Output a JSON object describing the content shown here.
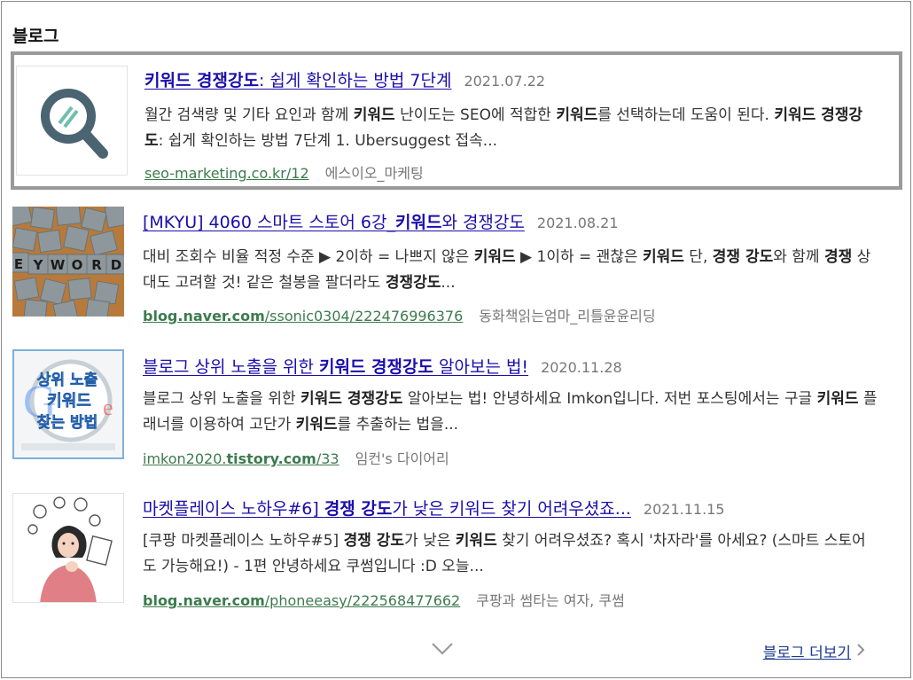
{
  "section": {
    "title": "블로그"
  },
  "items": [
    {
      "title_pre": "",
      "title_bold": "키워드 경쟁강도",
      "title_post": ": 쉽게 확인하는 방법 7단계",
      "date": "2021.07.22",
      "desc_html": "월간 검색량 및 기타 요인과 함께 <b>키워드</b> 난이도는 SEO에 적합한 <b>키워드</b>를 선택하는데 도움이 된다. <b>키워드 경쟁강도</b>: 쉽게 확인하는 방법 7단계 1. Ubersuggest 접속...",
      "url_pre": "seo-marketing.co.kr/12",
      "url_bold": "",
      "url_post": "",
      "writer": "에스이오_마케팅",
      "thumb_icon": "magnifier-icon"
    },
    {
      "title_pre": "[MKYU] 4060 스마트 스토어 6강_",
      "title_bold": "키워드",
      "title_post": "와 경쟁강도",
      "date": "2021.08.21",
      "desc_html": "대비 조회수 비율 적정 수준 ▶ 2이하 = 나쁘지 않은 <b>키워드</b> ▶ 1이하 = 괜찮은 <b>키워드</b>  단, <b>경쟁 강도</b>와 함께 <b>경쟁</b> 상대도 고려할 것!  같은 철봉을 팔더라도 <b>경쟁강도</b>...",
      "url_pre": "",
      "url_bold": "blog.naver.com",
      "url_post": "/ssonic0304/222476996376",
      "writer": "동화책읽는엄마_리틀윤윤리딩",
      "thumb_icon": "keyword-tiles-image"
    },
    {
      "title_pre": "블로그 상위 노출을 위한 ",
      "title_bold": "키워드 경쟁강도",
      "title_post": " 알아보는 법!",
      "date": "2020.11.28",
      "desc_html": "블로그 상위 노출을 위한 <b>키워드 경쟁강도</b> 알아보는 법! 안녕하세요 Imkon입니다. 저번 포스팅에서는 구글 <b>키워드</b> 플래너를 이용하여 고단가 <b>키워드</b>를 추출하는 법을...",
      "url_pre": "imkon2020.",
      "url_bold": "tistory.com",
      "url_post": "/33",
      "writer": "임컨's 다이어리",
      "thumb_icon": "google-keyword-thumb",
      "thumb_text": [
        "상위 노출",
        "키워드",
        "찾는 방법"
      ]
    },
    {
      "title_pre": "마켓플레이스 노하우#6] ",
      "title_bold": "경쟁 강도",
      "title_post": "가 낮은 키워드 찾기 어려우셨죠...",
      "date": "2021.11.15",
      "desc_html": "[쿠팡 마켓플레이스 노하우#5] <b>경쟁 강도</b>가 낮은 <b>키워드</b> 찾기 어려우셨죠? 혹시 '차자라'를 아세요? (스마트 스토어도 가능해요!) - 1편 안녕하세요 쿠썸입니다 :D 오늘...",
      "url_pre": "",
      "url_bold": "blog.naver.com",
      "url_post": "/phoneeasy/222568477662",
      "writer": "쿠팡과 썸타는 여자, 쿠썸",
      "thumb_icon": "thinking-woman-illustration"
    }
  ],
  "footer": {
    "more_label": "블로그 더보기",
    "expand_icon": "chevron-down-icon",
    "more_icon": "chevron-right-icon"
  },
  "colors": {
    "link": "#1a0dab",
    "url": "#3c7b4d",
    "date": "#777777",
    "highlight_border": "#9a9a9a"
  }
}
